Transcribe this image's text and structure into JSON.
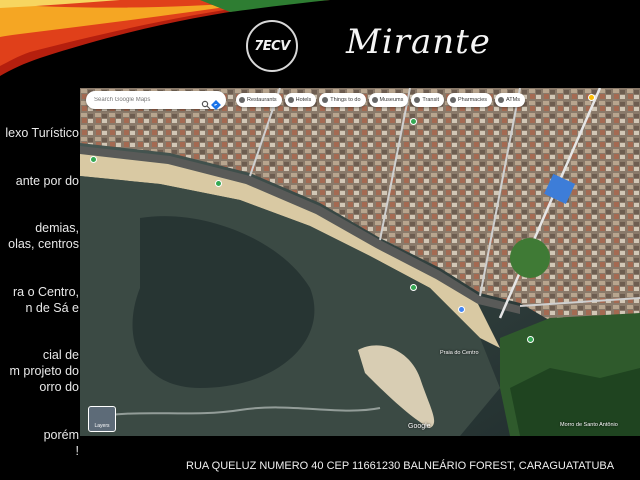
{
  "slide": {
    "title": "Mirante",
    "logo_text": "7ECV",
    "address": "RUA QUELUZ NUMERO 40  CEP 11661230 BALNEÁRIO FOREST, CARAGUATATUBA",
    "accent_colors": [
      "#e0401a",
      "#f5a623",
      "#2e7d32"
    ]
  },
  "left_text_lines": [
    "lexo Turístico",
    "ante por do",
    "demias,",
    "olas, centros",
    "ra o Centro,",
    "n de Sá e",
    "cial de",
    "m projeto do",
    "orro do",
    "porém",
    "!"
  ],
  "map": {
    "search_placeholder": "Search Google Maps",
    "chips": [
      {
        "label": "Restaurants",
        "icon": "restaurant-icon"
      },
      {
        "label": "Hotels",
        "icon": "hotel-icon"
      },
      {
        "label": "Things to do",
        "icon": "attraction-icon"
      },
      {
        "label": "Museums",
        "icon": "museum-icon"
      },
      {
        "label": "Transit",
        "icon": "transit-icon"
      },
      {
        "label": "Pharmacies",
        "icon": "pharmacy-icon"
      },
      {
        "label": "ATMs",
        "icon": "atm-icon"
      }
    ],
    "layers_label": "Layers",
    "google_mark": "Google",
    "place_labels": [
      "Praia do Centro",
      "Morro de Santo Antônio"
    ]
  }
}
